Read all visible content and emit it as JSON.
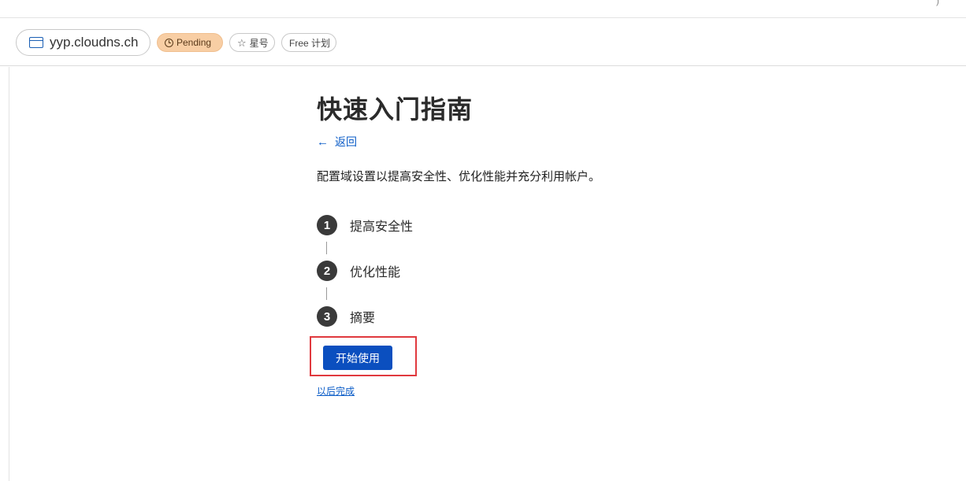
{
  "header": {
    "domain": "yyp.cloudns.ch",
    "domain_icon": "browser-window-icon",
    "status_badge": "Pending",
    "status_icon": "clock-icon",
    "star_label": "星号",
    "star_icon": "star-outline-icon",
    "plan_badge": "Free 计划"
  },
  "main": {
    "title": "快速入门指南",
    "back_label": "返回",
    "back_icon": "arrow-left-icon",
    "intro": "配置域设置以提高安全性、优化性能并充分利用帐户。",
    "steps": [
      {
        "number": "1",
        "label": "提高安全性"
      },
      {
        "number": "2",
        "label": "优化性能"
      },
      {
        "number": "3",
        "label": "摘要"
      }
    ],
    "start_button": "开始使用",
    "later_link": "以后完成"
  },
  "colors": {
    "accent": "#0b4fbf",
    "link": "#0b5cc7",
    "pending_badge_bg": "#f8cea4",
    "highlight_border": "#e0393e",
    "step_circle": "#3a3a3a"
  }
}
